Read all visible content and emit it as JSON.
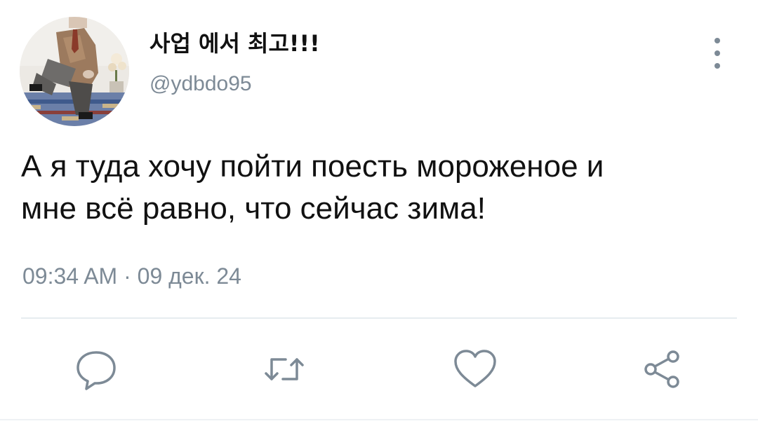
{
  "tweet": {
    "author": {
      "display_name": "사업 에서 최고!!!",
      "username": "@ydbdo95",
      "avatar_icon": "avatar-photo"
    },
    "text_line_1": "А я туда хочу пойти поесть мороженое и",
    "text_line_2": "мне всё равно, что сейчас зима!",
    "timestamp": "09:34 AM · 09 дек. 24",
    "more_icon": "vertical-ellipsis-icon"
  },
  "actions": [
    {
      "name": "reply",
      "icon": "speech-bubble-icon"
    },
    {
      "name": "retweet",
      "icon": "retweet-icon"
    },
    {
      "name": "like",
      "icon": "heart-icon"
    },
    {
      "name": "share",
      "icon": "share-icon"
    }
  ],
  "colors": {
    "text_primary": "#111111",
    "text_secondary": "#7d8a96",
    "divider": "#e6ecf0",
    "icon": "#7d8a96"
  }
}
